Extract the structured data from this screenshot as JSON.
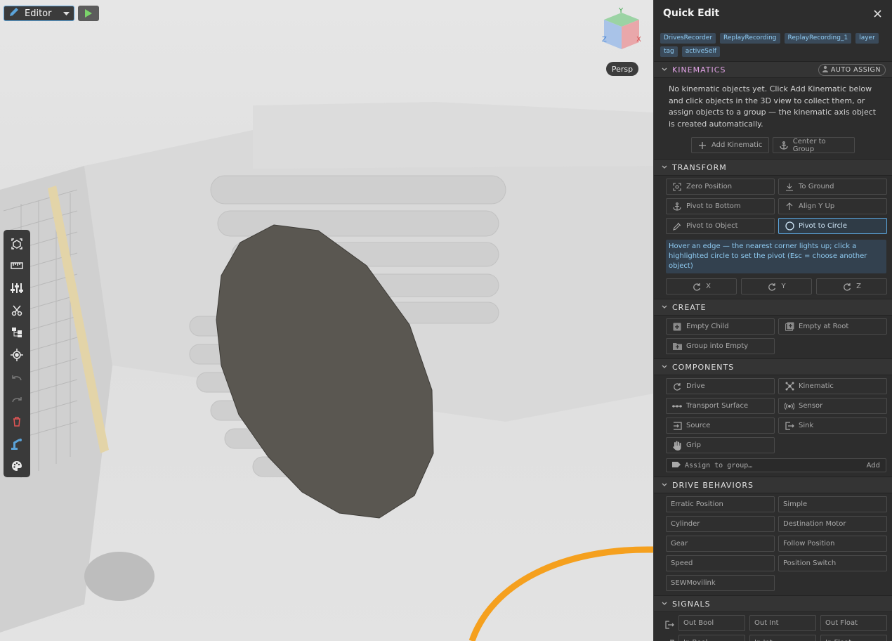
{
  "editor": {
    "mode_label": "Editor",
    "colors": {
      "accent": "#5ba3d9",
      "play": "#7bd36b",
      "delete": "#e05555"
    }
  },
  "toolbar": {
    "tools": [
      "select-box-icon",
      "ruler-icon",
      "sliders-icon",
      "scissors-icon",
      "hierarchy-icon",
      "target-icon",
      "undo-icon",
      "redo-icon",
      "delete-icon",
      "robot-arm-icon",
      "palette-icon"
    ]
  },
  "viewport": {
    "gizmo": {
      "x_label": "X",
      "y_label": "Y",
      "z_label": "Z"
    },
    "persp_label": "Persp"
  },
  "panel": {
    "title": "Quick Edit",
    "tags": [
      "DrivesRecorder",
      "ReplayRecording",
      "ReplayRecording_1",
      "layer",
      "tag",
      "activeSelf"
    ],
    "kinematics": {
      "title": "KINEMATICS",
      "auto_assign_label": "AUTO ASSIGN",
      "hint": "No kinematic objects yet. Click Add Kinematic below and click objects in the 3D view to collect them, or assign objects to a group — the kinematic axis object is created automatically.",
      "add_label": "Add Kinematic",
      "center_label": "Center to Group"
    },
    "transform": {
      "title": "TRANSFORM",
      "buttons": [
        "Zero Position",
        "To Ground",
        "Pivot to Bottom",
        "Align Y Up",
        "Pivot to Object",
        "Pivot to Circle"
      ],
      "info": "Hover an edge — the nearest corner lights up; click a highlighted circle to set the pivot (Esc = choose another object)",
      "axes": [
        "X",
        "Y",
        "Z"
      ]
    },
    "create": {
      "title": "CREATE",
      "buttons": [
        "Empty Child",
        "Empty at Root",
        "Group into Empty"
      ]
    },
    "components": {
      "title": "COMPONENTS",
      "buttons": [
        "Drive",
        "Kinematic",
        "Transport Surface",
        "Sensor",
        "Source",
        "Sink",
        "Grip"
      ],
      "assign_label": "Assign to group…",
      "assign_add": "Add"
    },
    "drive_behaviors": {
      "title": "DRIVE BEHAVIORS",
      "buttons": [
        "Erratic Position",
        "Simple",
        "Cylinder",
        "Destination Motor",
        "Gear",
        "Follow Position",
        "Speed",
        "Position Switch",
        "SEWMovilink"
      ]
    },
    "signals": {
      "title": "SIGNALS",
      "row1": [
        "Out Bool",
        "Out Int",
        "Out Float"
      ],
      "row2": [
        "In Bool",
        "In Int",
        "In Float"
      ]
    }
  }
}
